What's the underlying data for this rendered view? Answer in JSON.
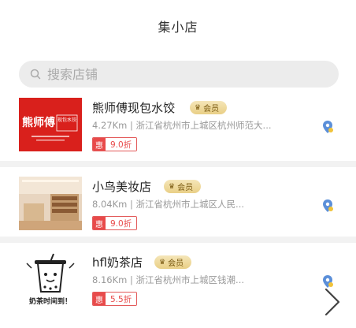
{
  "header": {
    "title": "集小店"
  },
  "search": {
    "placeholder": "搜索店铺"
  },
  "stores": [
    {
      "name": "熊师傅现包水饺",
      "badge": "会员",
      "distance": "4.27Km",
      "address": "浙江省杭州市上城区杭州师范大...",
      "promo_tag": "惠",
      "discount": "9.0折",
      "logo_text": "熊师傅",
      "logo_sub": "现包水饺"
    },
    {
      "name": "小鸟美妆店",
      "badge": "会员",
      "distance": "8.04Km",
      "address": "浙江省杭州市上城区人民...",
      "promo_tag": "惠",
      "discount": "9.0折"
    },
    {
      "name": "hfl奶茶店",
      "badge": "会员",
      "distance": "8.16Km",
      "address": "浙江省杭州市上城区钱潮...",
      "promo_tag": "惠",
      "discount": "5.5折",
      "logo_text": "奶茶时间到！"
    }
  ],
  "colors": {
    "accent_red": "#e84a4a",
    "badge_gold": "#e9cf86",
    "location_blue": "#5b8fd9"
  },
  "icons": {
    "search": "search-icon",
    "location": "location-pin-icon",
    "next": "chevron-right-icon"
  }
}
